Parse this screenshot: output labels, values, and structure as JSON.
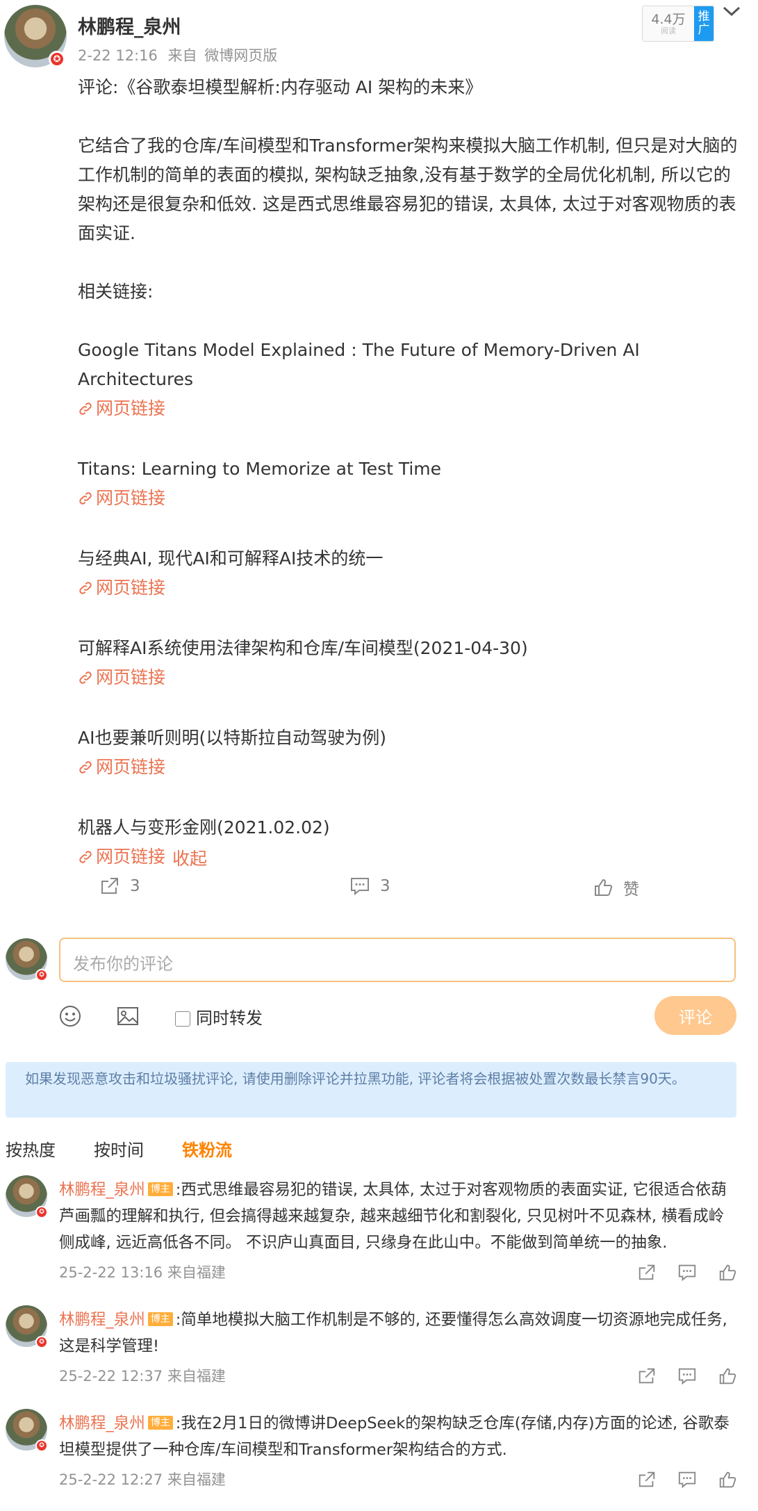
{
  "post": {
    "author": "林鹏程_泉州",
    "time": "2-22 12:16",
    "from_label": "来自",
    "source": "微博网页版",
    "reads": "4.4万",
    "reads_label": "阅读",
    "promote_label": "推广",
    "title_line": "评论:《谷歌泰坦模型解析:内存驱动 AI 架构的未来》",
    "body": "它结合了我的仓库/车间模型和Transformer架构来模拟大脑工作机制, 但只是对大脑的工作机制的简单的表面的模拟, 架构缺乏抽象,没有基于数学的全局优化机制, 所以它的架构还是很复杂和低效. 这是西式思维最容易犯的错误, 太具体, 太过于对客观物质的表面实证.",
    "related_label": "相关链接:",
    "links": [
      {
        "title": "Google Titans Model Explained : The Future of Memory-Driven AI Architectures",
        "link_text": "网页链接"
      },
      {
        "title": "Titans: Learning to Memorize at Test Time",
        "link_text": "网页链接"
      },
      {
        "title": "与经典AI, 现代AI和可解释AI技术的统一",
        "link_text": "网页链接"
      },
      {
        "title": "可解释AI系统使用法律架构和仓库/车间模型(2021-04-30)",
        "link_text": "网页链接"
      },
      {
        "title": "AI也要兼听则明(以特斯拉自动驾驶为例)",
        "link_text": "网页链接"
      },
      {
        "title": "机器人与变形金刚(2021.02.02)",
        "link_text": "网页链接"
      }
    ],
    "collapse_label": "收起",
    "actions": {
      "repost_count": "3",
      "comment_count": "3",
      "like_label": "赞"
    }
  },
  "composer": {
    "placeholder": "发布你的评论",
    "forward_label": "同时转发",
    "submit_label": "评论"
  },
  "notice": "如果发现恶意攻击和垃圾骚扰评论, 请使用删除评论并拉黑功能, 评论者将会根据被处置次数最长禁言90天。",
  "sort_tabs": [
    "按热度",
    "按时间",
    "铁粉流"
  ],
  "active_sort": "铁粉流",
  "comments": [
    {
      "author": "林鹏程_泉州",
      "badge": "博主",
      "text": ":西式思维最容易犯的错误, 太具体, 太过于对客观物质的表面实证, 它很适合依葫芦画瓢的理解和执行, 但会搞得越来越复杂, 越来越细节化和割裂化, 只见树叶不见森林, 横看成岭侧成峰, 远近高低各不同。 不识庐山真面目, 只缘身在此山中。不能做到简单统一的抽象.",
      "time": "25-2-22 13:16",
      "from": "来自福建"
    },
    {
      "author": "林鹏程_泉州",
      "badge": "博主",
      "text": ":简单地模拟大脑工作机制是不够的, 还要懂得怎么高效调度一切资源地完成任务, 这是科学管理!",
      "time": "25-2-22 12:37",
      "from": "来自福建"
    },
    {
      "author": "林鹏程_泉州",
      "badge": "博主",
      "text": ":我在2月1日的微博讲DeepSeek的架构缺乏仓库(存储,内存)方面的论述, 谷歌泰坦模型提供了一种仓库/车间模型和Transformer架构结合的方式.",
      "time": "25-2-22 12:27",
      "from": "来自福建"
    }
  ]
}
